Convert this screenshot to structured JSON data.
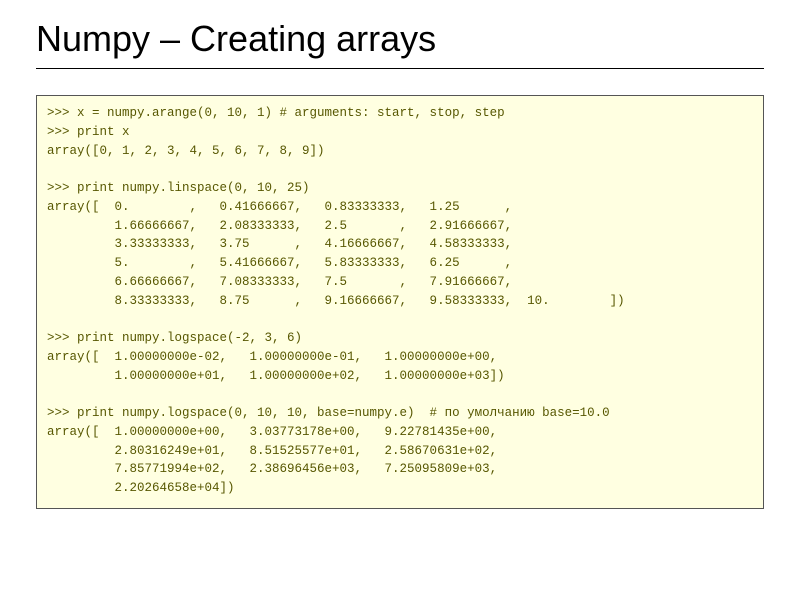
{
  "title": "Numpy – Creating arrays",
  "code": ">>> x = numpy.arange(0, 10, 1) # arguments: start, stop, step\n>>> print x\narray([0, 1, 2, 3, 4, 5, 6, 7, 8, 9])\n\n>>> print numpy.linspace(0, 10, 25)\narray([  0.        ,   0.41666667,   0.83333333,   1.25      ,\n         1.66666667,   2.08333333,   2.5       ,   2.91666667,\n         3.33333333,   3.75      ,   4.16666667,   4.58333333,\n         5.        ,   5.41666667,   5.83333333,   6.25      ,\n         6.66666667,   7.08333333,   7.5       ,   7.91666667,\n         8.33333333,   8.75      ,   9.16666667,   9.58333333,  10.        ])\n\n>>> print numpy.logspace(-2, 3, 6)\narray([  1.00000000e-02,   1.00000000e-01,   1.00000000e+00,\n         1.00000000e+01,   1.00000000e+02,   1.00000000e+03])\n\n>>> print numpy.logspace(0, 10, 10, base=numpy.e)  # по умолчанию base=10.0\narray([  1.00000000e+00,   3.03773178e+00,   9.22781435e+00,\n         2.80316249e+01,   8.51525577e+01,   2.58670631e+02,\n         7.85771994e+02,   2.38696456e+03,   7.25095809e+03,\n         2.20264658e+04])"
}
